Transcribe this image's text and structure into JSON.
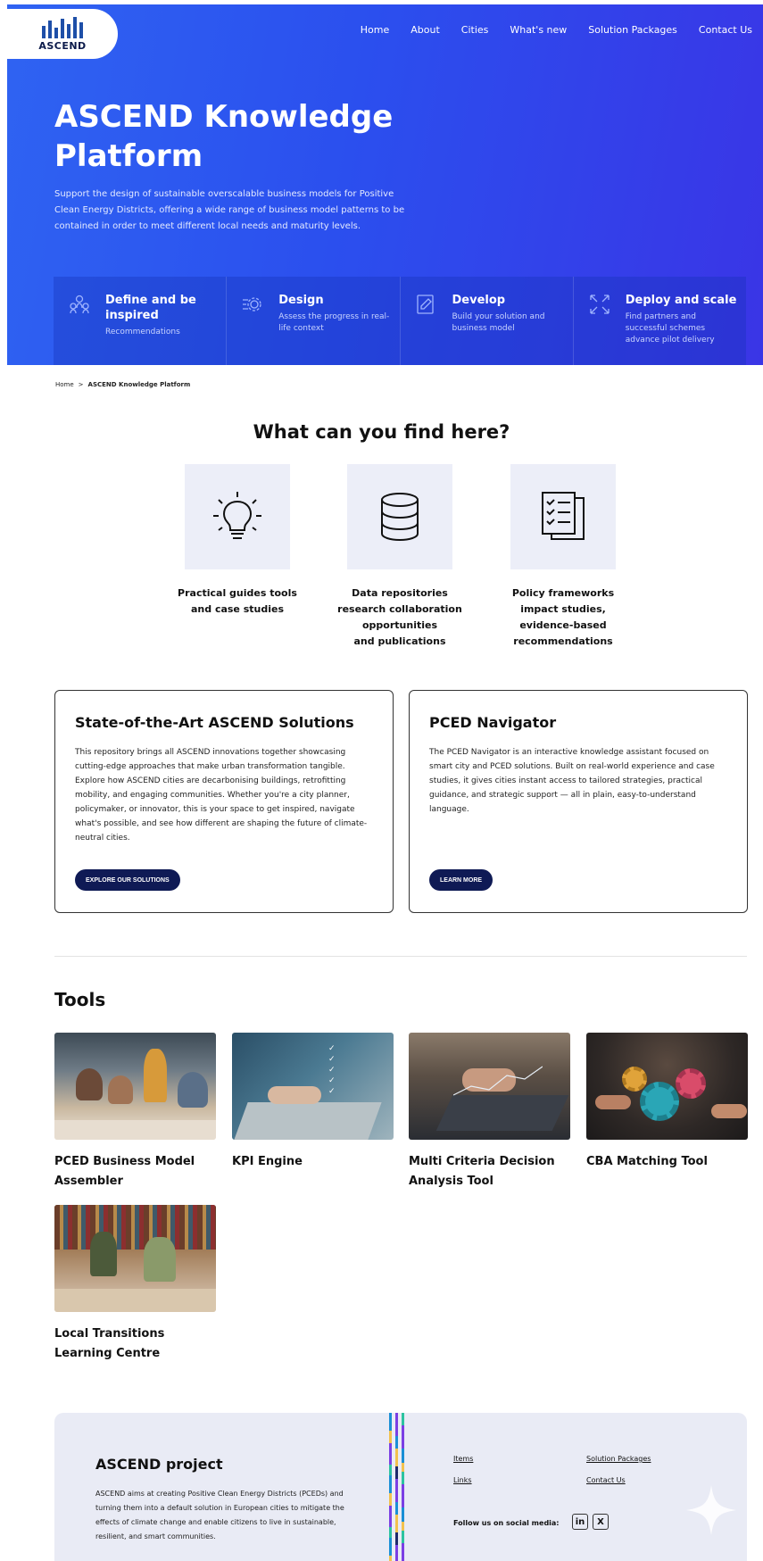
{
  "header": {
    "logo_text": "ASCEND",
    "nav": [
      "Home",
      "About",
      "Cities",
      "What's new",
      "Solution Packages",
      "Contact Us"
    ]
  },
  "hero": {
    "title": "ASCEND Knowledge Platform",
    "description": "Support the design of sustainable overscalable business models for Positive Clean Energy Districts, offering a wide range of business model patterns to be contained in order to meet different local needs and maturity levels.",
    "steps": [
      {
        "title": "Define and be inspired",
        "desc": "Recommendations",
        "icon": "people-icon"
      },
      {
        "title": "Design",
        "desc": "Assess the progress in real-life context",
        "icon": "gear-icon"
      },
      {
        "title": "Develop",
        "desc": "Build your solution and business model",
        "icon": "tablet-edit-icon"
      },
      {
        "title": "Deploy and scale",
        "desc": "Find partners and successful schemes advance pilot delivery",
        "icon": "expand-icon"
      }
    ]
  },
  "breadcrumb": {
    "home": "Home",
    "separator": ">",
    "current": "ASCEND Knowledge Platform"
  },
  "find": {
    "title": "What can you find here?",
    "items": [
      {
        "label": "Practical guides tools\nand case studies",
        "icon": "lightbulb-icon"
      },
      {
        "label": "Data repositories\nresearch collaboration\nopportunities\nand publications",
        "icon": "database-icon"
      },
      {
        "label": "Policy frameworks\nimpact studies,\nevidence-based\nrecommendations",
        "icon": "checklist-icon"
      }
    ]
  },
  "cards": [
    {
      "title": "State-of-the-Art ASCEND Solutions",
      "text": "This repository brings all ASCEND innovations together showcasing cutting-edge approaches that make urban transformation tangible. Explore how ASCEND cities are decarbonising buildings, retrofitting mobility, and engaging communities. Whether you're a city planner, policymaker, or innovator, this is your space to get inspired, navigate what's possible, and see how different are shaping the future of climate-neutral cities.",
      "button": "EXPLORE OUR SOLUTIONS"
    },
    {
      "title": "PCED Navigator",
      "text": "The PCED Navigator is an interactive knowledge assistant focused on smart city and PCED solutions. Built on real-world experience and case studies, it gives cities instant access to tailored strategies, practical guidance, and strategic support — all in plain, easy-to-understand language.",
      "button": "LEARN MORE"
    }
  ],
  "tools": {
    "title": "Tools",
    "items": [
      {
        "name": "PCED Business Model Assembler",
        "image": "team-meeting-photo"
      },
      {
        "name": "KPI Engine",
        "image": "laptop-checklist-photo"
      },
      {
        "name": "Multi Criteria Decision Analysis Tool",
        "image": "chart-analysis-photo"
      },
      {
        "name": "CBA Matching Tool",
        "image": "gears-teamwork-photo"
      },
      {
        "name": "Local Transitions Learning Centre",
        "image": "library-study-photo"
      }
    ]
  },
  "footer": {
    "title": "ASCEND project",
    "text": "ASCEND aims at creating Positive Clean Energy Districts (PCEDs) and turning them into a default solution in European cities to mitigate the effects of climate change and enable citizens to live in sustainable, resilient, and smart communities.",
    "links": [
      "Items",
      "Links",
      "Solution Packages",
      "Contact Us"
    ],
    "social_label": "Follow us on social media:",
    "social": [
      "in",
      "X"
    ]
  },
  "colors": {
    "hero_start": "#2f63f2",
    "hero_end": "#3a35e6",
    "button_bg": "#0f1a55",
    "find_box": "#eceef8",
    "footer_bg": "#e9ebf5"
  }
}
